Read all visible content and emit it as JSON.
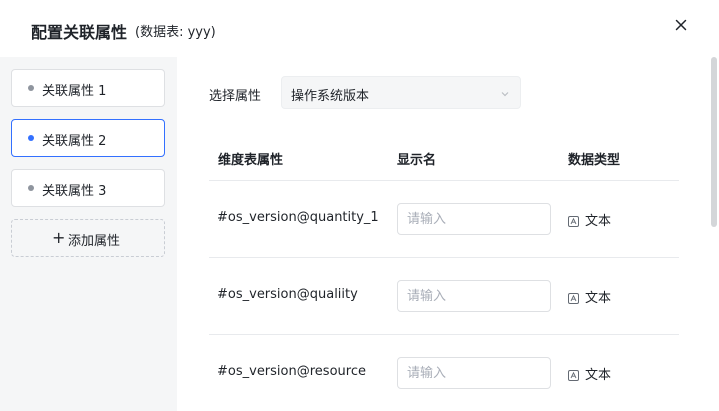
{
  "header": {
    "title": "配置关联属性",
    "subtitle": "(数据表: yyy)"
  },
  "sidebar": {
    "items": [
      {
        "label": "关联属性 1",
        "active": false
      },
      {
        "label": "关联属性 2",
        "active": true
      },
      {
        "label": "关联属性 3",
        "active": false
      }
    ],
    "add_label": "添加属性"
  },
  "main": {
    "select_label": "选择属性",
    "select_value": "操作系统版本",
    "columns": [
      "维度表属性",
      "显示名",
      "数据类型"
    ],
    "rows": [
      {
        "attr": "#os_version@quantity_1",
        "placeholder": "请输入",
        "type": "文本"
      },
      {
        "attr": "#os_version@qualiity",
        "placeholder": "请输入",
        "type": "文本"
      },
      {
        "attr": "#os_version@resource",
        "placeholder": "请输入",
        "type": "文本"
      }
    ]
  },
  "colors": {
    "accent": "#3370ff",
    "sidebar_bg": "#f5f6f7",
    "dot_inactive": "#8f959e"
  },
  "icons": {
    "close": "close-icon",
    "chevron": "chevron-down-icon",
    "plus": "plus-icon",
    "text_type": "text-type-icon"
  }
}
